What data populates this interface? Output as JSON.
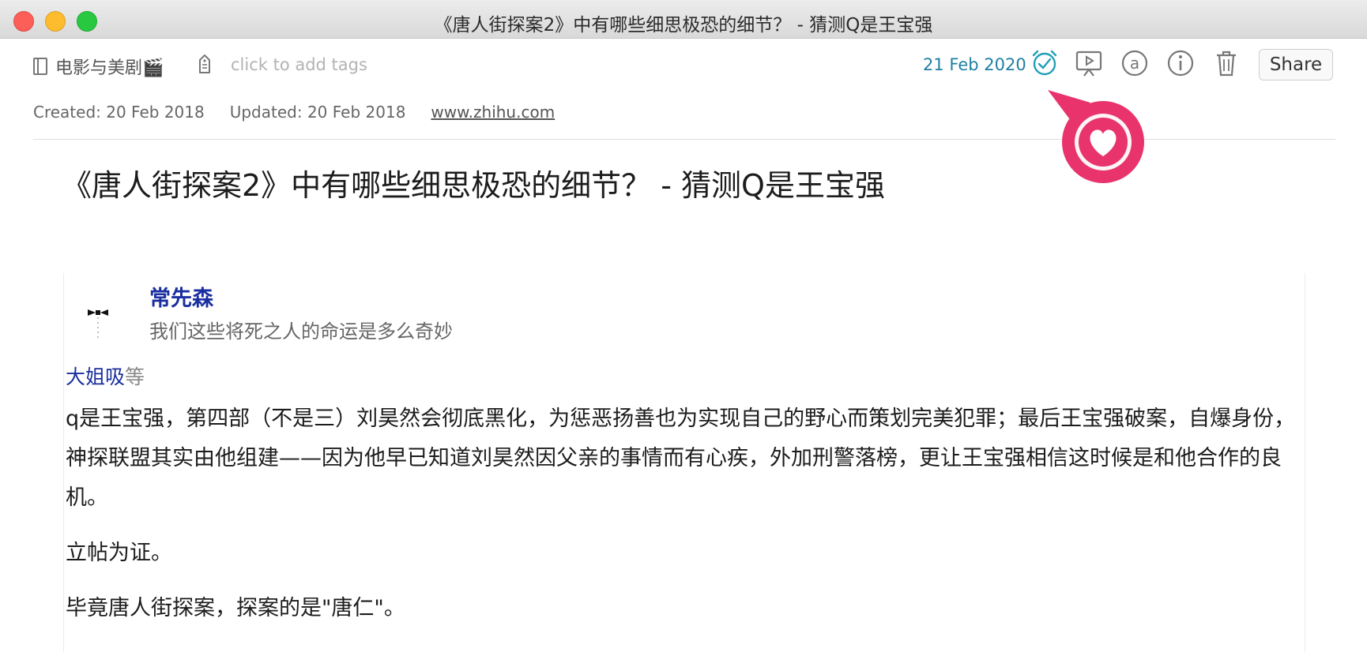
{
  "window": {
    "title": "《唐人街探案2》中有哪些细思极恐的细节？ - 猜测Q是王宝强"
  },
  "toolbar": {
    "notebook": "电影与美剧🎬",
    "tags_placeholder": "click to add tags",
    "reminder_date": "21 Feb 2020",
    "share_label": "Share",
    "icons": [
      "notebook-icon",
      "tag-icon",
      "alarm-check-icon",
      "present-icon",
      "at-icon",
      "info-icon",
      "trash-icon"
    ]
  },
  "meta": {
    "created": "Created: 20 Feb 2018",
    "updated": "Updated: 20 Feb 2018",
    "source": "www.zhihu.com"
  },
  "note": {
    "title": "《唐人街探案2》中有哪些细思极恐的细节？ - 猜测Q是王宝强",
    "author_name": "常先森",
    "author_bio": "我们这些将死之人的命运是多么奇妙",
    "voter_name": "大姐吸",
    "voter_suffix": "等",
    "paragraphs": [
      "q是王宝强，第四部（不是三）刘昊然会彻底黑化，为惩恶扬善也为实现自己的野心而策划完美犯罪；最后王宝强破案，自爆身份，神探联盟其实由他组建——因为他早已知道刘昊然因父亲的事情而有心疾，外加刑警落榜，更让王宝强相信这时候是和他合作的良机。",
      "立帖为证。",
      "毕竟唐人街探案，探案的是\"唐仁\"。"
    ]
  },
  "colors": {
    "accent": "#1f7fa3",
    "link": "#1a2fa0",
    "callout": "#e8336d"
  }
}
